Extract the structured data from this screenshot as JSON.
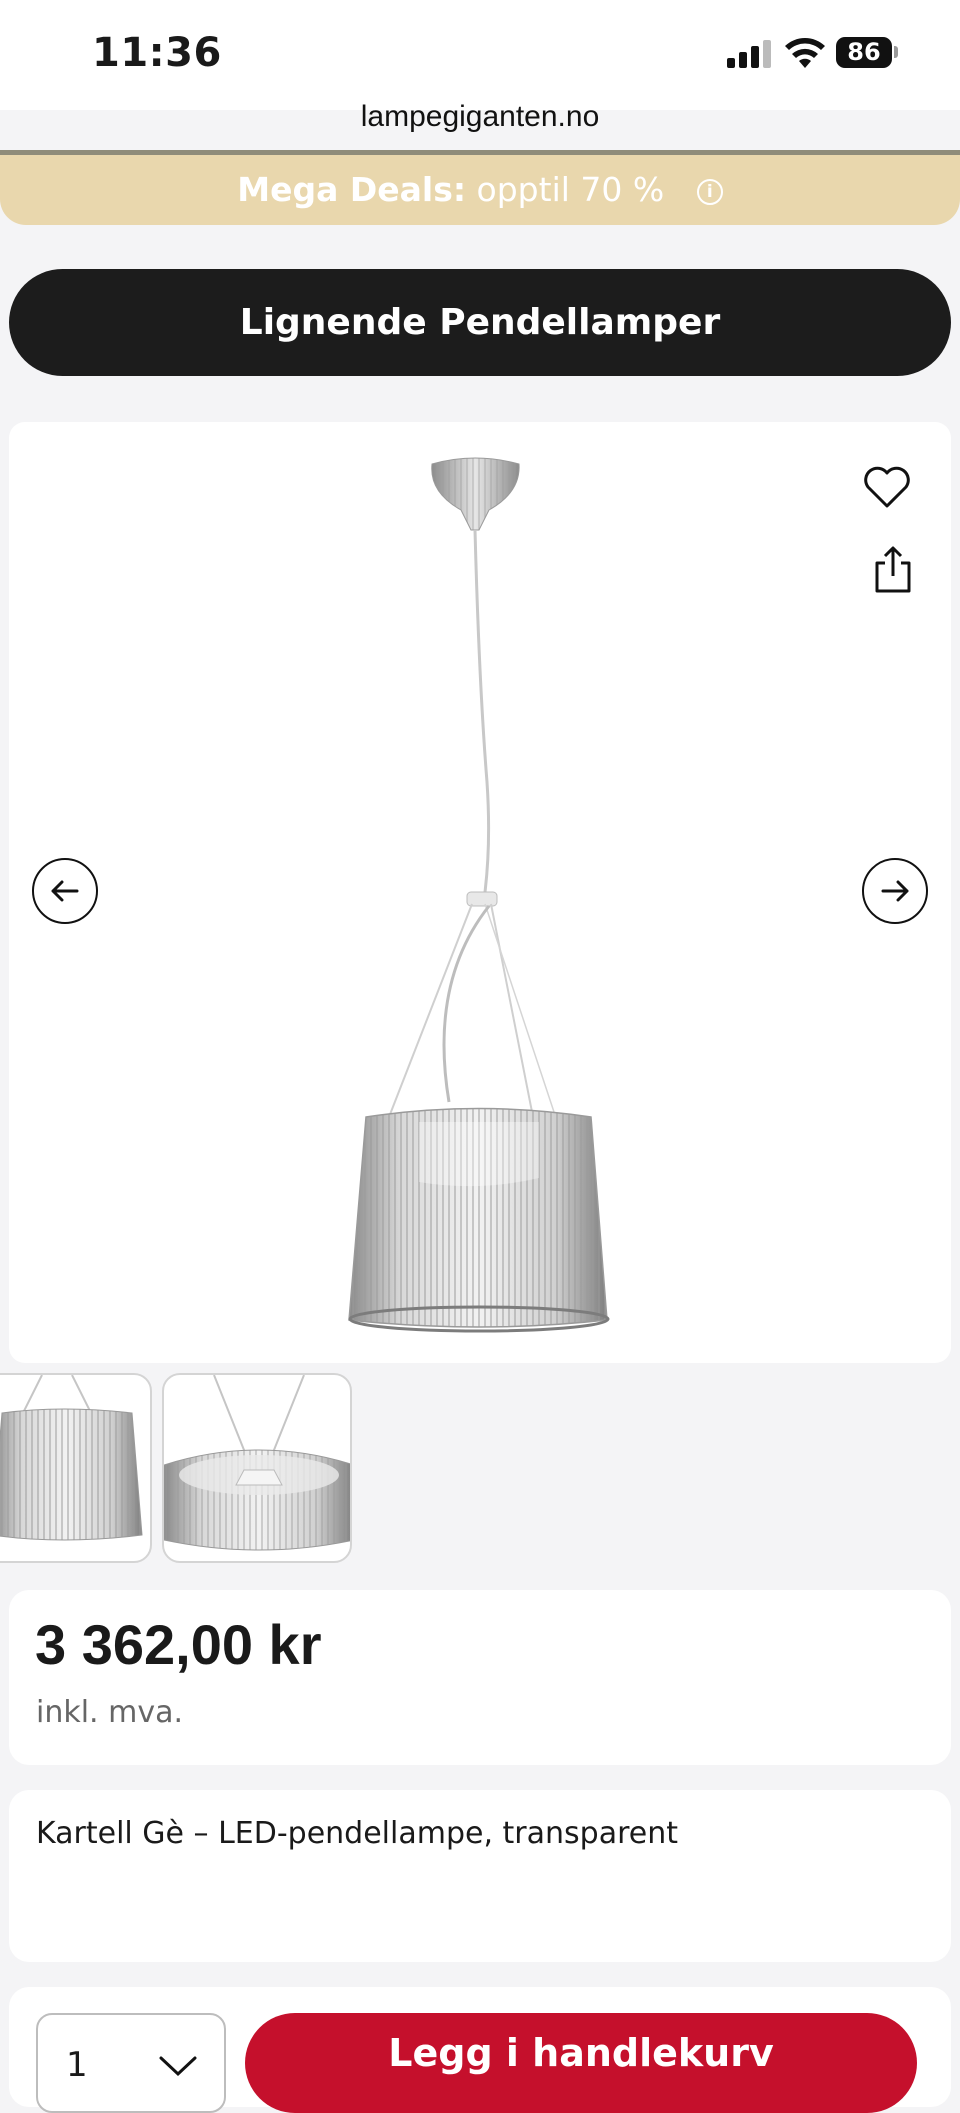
{
  "status_bar": {
    "time": "11:36",
    "battery": "86"
  },
  "browser": {
    "url": "lampegiganten.no"
  },
  "promo_banner": {
    "bold": "Mega Deals:",
    "text": "opptil 70 %",
    "info_symbol": "i",
    "background": "#e9d7ad"
  },
  "similar_button": {
    "label": "Lignende Pendellamper"
  },
  "product": {
    "price": "3 362,00 kr",
    "vat_note": "inkl. mva.",
    "title": "Kartell Gè – LED-pendellampe, transparent"
  },
  "gallery": {
    "icons": [
      "heart-icon",
      "share-icon",
      "arrow-left-icon",
      "arrow-right-icon"
    ]
  },
  "purchase": {
    "quantity": "1",
    "add_to_cart_label": "Legg i handlekurv",
    "button_color": "#c5102c"
  }
}
